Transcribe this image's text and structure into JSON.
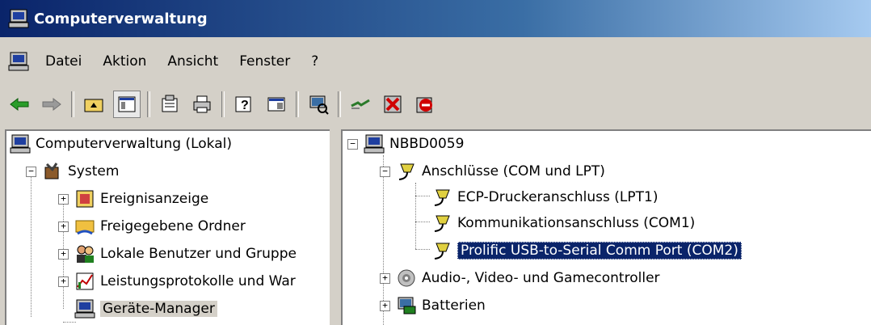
{
  "window": {
    "title": "Computerverwaltung"
  },
  "menu": {
    "items": [
      "Datei",
      "Aktion",
      "Ansicht",
      "Fenster",
      "?"
    ]
  },
  "toolbar": {
    "buttons": [
      "back-icon",
      "forward-icon",
      "up-folder-icon",
      "show-tree-icon",
      "properties-icon",
      "print-icon",
      "help-icon",
      "export-list-icon",
      "scan-hardware-icon",
      "update-driver-icon",
      "disable-device-icon",
      "uninstall-device-icon"
    ]
  },
  "left_tree": {
    "items": [
      {
        "label": "Computerverwaltung (Lokal)",
        "icon": "computer-icon"
      },
      {
        "label": "System",
        "icon": "tools-icon"
      },
      {
        "label": "Ereignisanzeige",
        "icon": "event-viewer-icon"
      },
      {
        "label": "Freigegebene Ordner",
        "icon": "shared-folder-icon"
      },
      {
        "label": "Lokale Benutzer und Gruppe",
        "icon": "users-icon"
      },
      {
        "label": "Leistungsprotokolle und War",
        "icon": "performance-icon"
      },
      {
        "label": "Geräte-Manager",
        "icon": "device-manager-icon"
      }
    ]
  },
  "right_tree": {
    "items": [
      {
        "label": "NBBD0059",
        "icon": "computer-icon"
      },
      {
        "label": "Anschlüsse (COM und LPT)",
        "icon": "port-icon"
      },
      {
        "label": "ECP-Druckeranschluss (LPT1)",
        "icon": "port-icon"
      },
      {
        "label": "Kommunikationsanschluss (COM1)",
        "icon": "port-icon"
      },
      {
        "label": "Prolific USB-to-Serial Comm Port (COM2)",
        "icon": "port-icon"
      },
      {
        "label": "Audio-, Video- und Gamecontroller",
        "icon": "speaker-icon"
      },
      {
        "label": "Batterien",
        "icon": "battery-icon"
      }
    ]
  }
}
